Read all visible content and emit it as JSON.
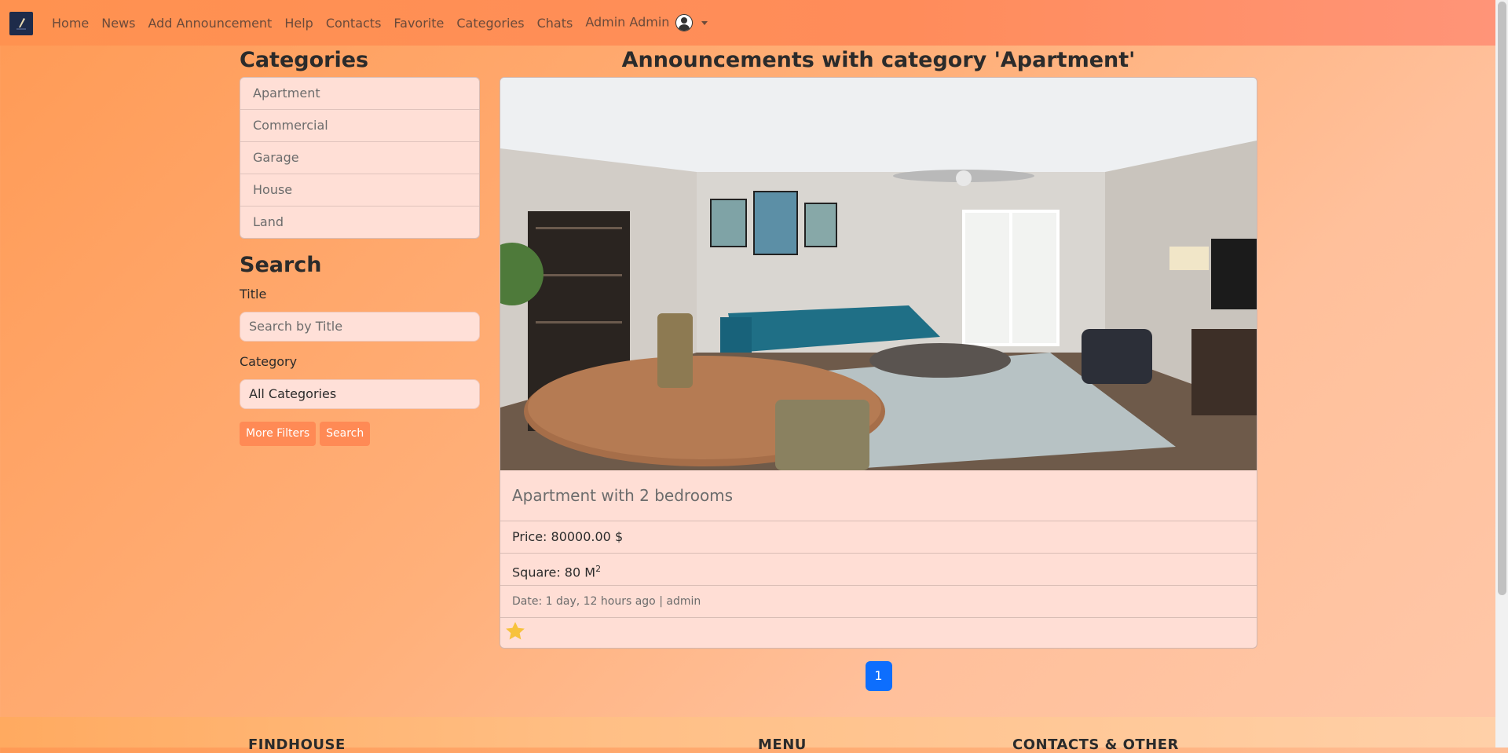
{
  "nav": {
    "items": [
      "Home",
      "News",
      "Add Announcement",
      "Help",
      "Contacts",
      "Favorite",
      "Categories",
      "Chats"
    ],
    "user": "Admin Admin"
  },
  "sidebar": {
    "categories_heading": "Categories",
    "categories": [
      "Apartment",
      "Commercial",
      "Garage",
      "House",
      "Land"
    ],
    "search_heading": "Search",
    "title_label": "Title",
    "title_placeholder": "Search by Title",
    "category_label": "Category",
    "category_value": "All Categories",
    "more_filters": "More Filters",
    "search_button": "Search"
  },
  "main": {
    "heading": "Announcements with category 'Apartment'",
    "card": {
      "title": "Apartment with 2 bedrooms",
      "price": "Price: 80000.00 $",
      "square": "Square: 80 M",
      "square_sup": "2",
      "meta": "Date: 1 day, 12 hours ago | admin"
    },
    "page": "1"
  },
  "footer": {
    "col1": "FINDHOUSE",
    "col2": "MENU",
    "col3": "CONTACTS & OTHER"
  },
  "colors": {
    "accent": "#ff8a55",
    "page_active": "#0d6efd",
    "star": "#f7c23c"
  },
  "icons": [
    "logo-icon",
    "avatar-icon",
    "caret-down-icon",
    "star-icon"
  ]
}
